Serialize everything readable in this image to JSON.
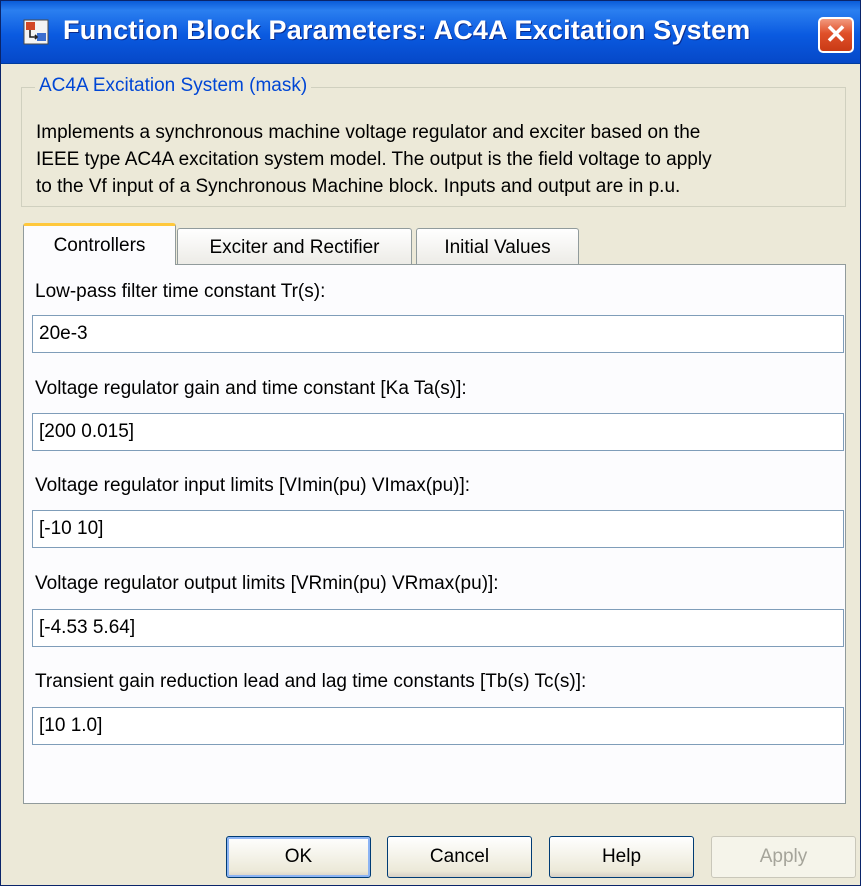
{
  "window": {
    "title": "Function Block Parameters: AC4A Excitation System",
    "icon": "simulink-block-icon",
    "close_glyph": "✕"
  },
  "mask": {
    "legend": "AC4A Excitation System (mask)",
    "description_lines": [
      "Implements a synchronous machine voltage regulator and exciter based on the",
      "IEEE type AC4A excitation system model. The output is the field voltage to apply",
      "to the Vf input of a Synchronous Machine block. Inputs and output are in p.u."
    ]
  },
  "tabs": [
    {
      "label": "Controllers",
      "active": true
    },
    {
      "label": "Exciter and Rectifier",
      "active": false
    },
    {
      "label": "Initial Values",
      "active": false
    }
  ],
  "params": [
    {
      "label": "Low-pass filter time constant Tr(s):",
      "value": "20e-3"
    },
    {
      "label": "Voltage regulator gain and time constant [Ka Ta(s)]:",
      "value": "[200 0.015]"
    },
    {
      "label": "Voltage regulator input limits [VImin(pu) VImax(pu)]:",
      "value": "[-10 10]"
    },
    {
      "label": "Voltage regulator output limits [VRmin(pu) VRmax(pu)]:",
      "value": "[-4.53 5.64]"
    },
    {
      "label": "Transient gain reduction lead and lag time constants [Tb(s) Tc(s)]:",
      "value": "[10 1.0]"
    }
  ],
  "buttons": {
    "ok": "OK",
    "cancel": "Cancel",
    "help": "Help",
    "apply": "Apply"
  },
  "colors": {
    "titlebar": "#0a5ae0",
    "legend_text": "#0046d5",
    "active_tab_accent": "#ffc83c",
    "dialog_bg": "#ece9d8"
  }
}
